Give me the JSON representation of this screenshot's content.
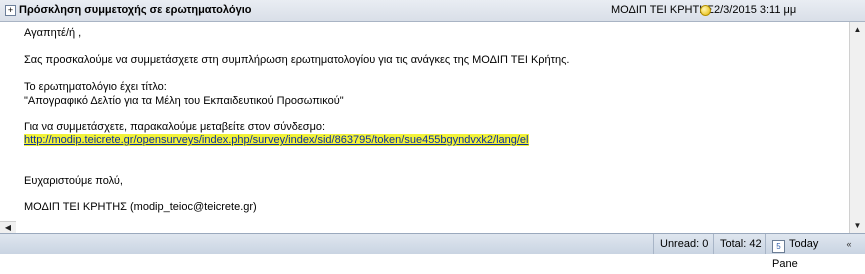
{
  "header": {
    "collapse_symbol": "+",
    "subject": "Πρόσκληση συμμετοχής σε ερωτηματολόγιο",
    "sender": "ΜΟΔΙΠ ΤΕΙ ΚΡΗΤΗΣ",
    "datetime": "2/3/2015 3:11 μμ",
    "icon": "flag-icon"
  },
  "body": {
    "greeting": "Αγαπητέ/ή ,",
    "invitation": "Σας προσκαλούμε να συμμετάσχετε στη συμπλήρωση ερωτηματολογίου για τις ανάγκες της ΜΟΔΙΠ ΤΕΙ Κρήτης.",
    "title_label": "Το ερωτηματολόγιο έχει τίτλο:",
    "survey_title": "\"Απογραφικό Δελτίο για τα Μέλη του Εκπαιδευτικού Προσωπικού\"",
    "link_intro": "Για να συμμετάσχετε, παρακαλούμε μεταβείτε στον σύνδεσμο:",
    "link": "http://modip.teicrete.gr/opensurveys/index.php/survey/index/sid/863795/token/sue455bgyndvxk2/lang/el",
    "thanks": "Ευχαριστούμε πολύ,",
    "signature": "ΜΟΔΙΠ ΤΕΙ ΚΡΗΤΗΣ (modip_teioc@teicrete.gr)",
    "link_color": "#0b2f9e",
    "highlight_color": "#f2f23a"
  },
  "scrollbar": {
    "up_arrow": "▲",
    "down_arrow": "▼",
    "left_arrow": "◀"
  },
  "statusbar": {
    "unread": "Unread: 0",
    "total": "Total: 42",
    "today_pane": "Today Pane",
    "today_icon_text": "5",
    "toggle": "«"
  }
}
